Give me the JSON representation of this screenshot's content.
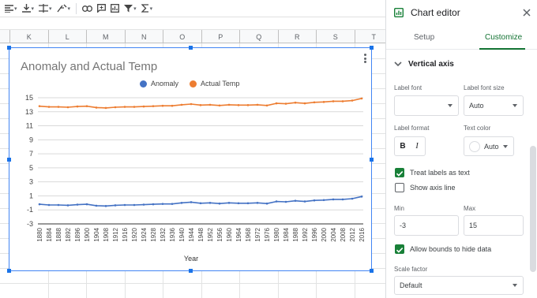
{
  "toolbar": {
    "icons": [
      "align-left-icon",
      "align-bottom-icon",
      "text-direction-icon",
      "text-rotate-icon",
      "link-icon",
      "comment-icon",
      "chart-icon",
      "filter-icon",
      "function-icon"
    ]
  },
  "sheet": {
    "columns": [
      "K",
      "L",
      "M",
      "N",
      "O",
      "P",
      "Q",
      "R",
      "S",
      "T"
    ]
  },
  "chart": {
    "title": "Anomaly and Actual Temp",
    "legend": [
      {
        "label": "Anomaly",
        "color": "#4472c4"
      },
      {
        "label": "Actual Temp",
        "color": "#ed7d31"
      }
    ],
    "xlabel": "Year"
  },
  "chart_data": {
    "type": "line",
    "title": "Anomaly and Actual Temp",
    "xlabel": "Year",
    "ylabel": "",
    "ylim": [
      -3,
      15
    ],
    "yticks": [
      15,
      13,
      11,
      9,
      7,
      5,
      3,
      1,
      -1,
      -3
    ],
    "x": [
      1880,
      1884,
      1888,
      1892,
      1896,
      1900,
      1904,
      1908,
      1912,
      1916,
      1920,
      1924,
      1928,
      1932,
      1936,
      1940,
      1944,
      1948,
      1952,
      1956,
      1960,
      1964,
      1968,
      1972,
      1976,
      1980,
      1984,
      1988,
      1992,
      1996,
      2000,
      2004,
      2008,
      2012,
      2016
    ],
    "legend_position": "top",
    "grid": true,
    "series": [
      {
        "name": "Anomaly",
        "color": "#4472c4",
        "values": [
          -0.2,
          -0.3,
          -0.3,
          -0.35,
          -0.25,
          -0.2,
          -0.4,
          -0.45,
          -0.35,
          -0.3,
          -0.3,
          -0.25,
          -0.2,
          -0.15,
          -0.15,
          0.0,
          0.1,
          -0.05,
          0.0,
          -0.1,
          0.0,
          -0.05,
          -0.05,
          0.0,
          -0.1,
          0.2,
          0.15,
          0.3,
          0.2,
          0.35,
          0.4,
          0.5,
          0.5,
          0.6,
          0.9
        ]
      },
      {
        "name": "Actual Temp",
        "color": "#ed7d31",
        "values": [
          13.8,
          13.7,
          13.7,
          13.65,
          13.75,
          13.8,
          13.6,
          13.55,
          13.65,
          13.7,
          13.7,
          13.75,
          13.8,
          13.85,
          13.85,
          14.0,
          14.1,
          13.95,
          14.0,
          13.9,
          14.0,
          13.95,
          13.95,
          14.0,
          13.9,
          14.2,
          14.15,
          14.3,
          14.2,
          14.35,
          14.4,
          14.5,
          14.5,
          14.6,
          14.9
        ]
      }
    ]
  },
  "panel": {
    "title": "Chart editor",
    "tabs": {
      "setup": "Setup",
      "customize": "Customize"
    },
    "section": "Vertical axis",
    "label_font": {
      "label": "Label font",
      "value": ""
    },
    "label_font_size": {
      "label": "Label font size",
      "value": "Auto"
    },
    "label_format": {
      "label": "Label format",
      "bold": "B",
      "italic": "I"
    },
    "text_color": {
      "label": "Text color",
      "value": "Auto"
    },
    "treat_labels": {
      "label": "Treat labels as text",
      "checked": true
    },
    "show_axis_line": {
      "label": "Show axis line",
      "checked": false
    },
    "min": {
      "label": "Min",
      "value": "-3"
    },
    "max": {
      "label": "Max",
      "value": "15"
    },
    "allow_bounds": {
      "label": "Allow bounds to hide data",
      "checked": true
    },
    "scale_factor": {
      "label": "Scale factor",
      "value": "Default"
    },
    "accent": "#137333"
  }
}
